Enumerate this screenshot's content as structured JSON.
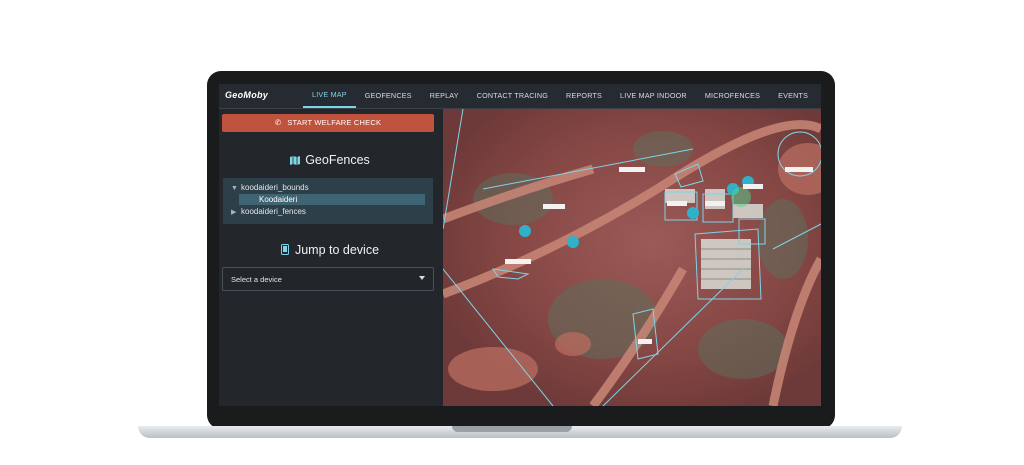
{
  "app": {
    "logo_text": "GeoMoby"
  },
  "nav": {
    "tabs": [
      {
        "label": "LIVE MAP",
        "active": true
      },
      {
        "label": "GEOFENCES",
        "active": false
      },
      {
        "label": "REPLAY",
        "active": false
      },
      {
        "label": "CONTACT TRACING",
        "active": false
      },
      {
        "label": "REPORTS",
        "active": false
      },
      {
        "label": "LIVE MAP INDOOR",
        "active": false
      },
      {
        "label": "MICROFENCES",
        "active": false
      },
      {
        "label": "EVENTS",
        "active": false
      }
    ]
  },
  "sidebar": {
    "welfare_button": "START WELFARE CHECK",
    "welfare_icon": "phone-icon",
    "geofences_title": "GeoFences",
    "geofences_icon": "map-icon",
    "tree": [
      {
        "label": "koodaideri_bounds",
        "expanded": true
      },
      {
        "label": "Koodaideri",
        "selected": true
      },
      {
        "label": "koodaideri_fences",
        "expanded": false
      }
    ],
    "jump_title": "Jump to device",
    "jump_icon": "phone-device-icon",
    "device_select": "Select a device"
  },
  "colors": {
    "accent": "#7fd3e8",
    "welfare": "#c0533e",
    "fence": "#7fd3e8",
    "marker": "#2fb2c9"
  }
}
